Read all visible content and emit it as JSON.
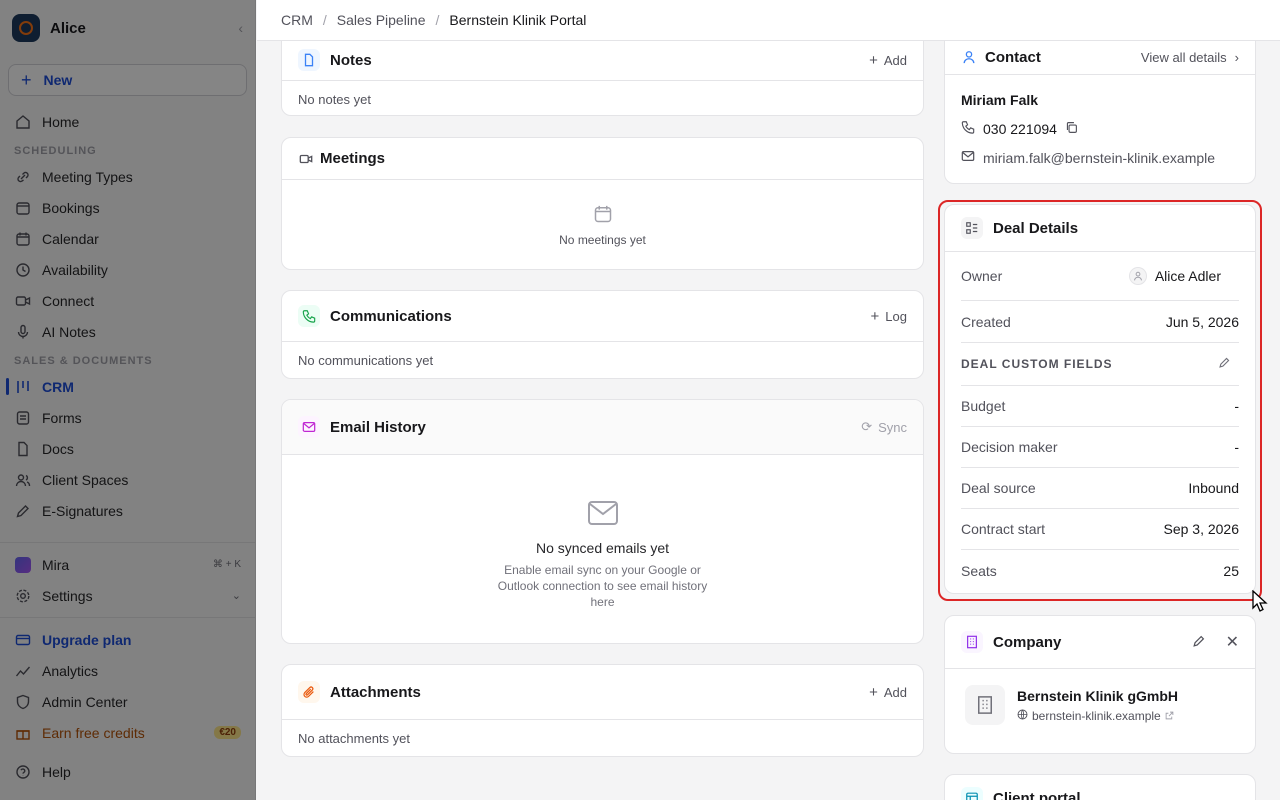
{
  "sidebar": {
    "workspace": "Alice",
    "new_label": "New",
    "home": "Home",
    "section_scheduling": "SCHEDULING",
    "scheduling": [
      "Meeting Types",
      "Bookings",
      "Calendar",
      "Availability",
      "Connect",
      "AI Notes"
    ],
    "section_sales": "SALES & DOCUMENTS",
    "sales": [
      "CRM",
      "Forms",
      "Docs",
      "Client Spaces",
      "E-Signatures"
    ],
    "mira": "Mira",
    "mira_kbd": "⌘ + K",
    "settings": "Settings",
    "upgrade": "Upgrade plan",
    "analytics": "Analytics",
    "admin": "Admin Center",
    "earn": "Earn free credits",
    "earn_badge": "€20",
    "help": "Help"
  },
  "breadcrumb": [
    "CRM",
    "Sales Pipeline",
    "Bernstein Klinik Portal"
  ],
  "notes": {
    "title": "Notes",
    "action": "Add",
    "empty": "No notes yet"
  },
  "meetings": {
    "title": "Meetings",
    "empty": "No meetings yet"
  },
  "communications": {
    "title": "Communications",
    "action": "Log",
    "empty": "No communications yet"
  },
  "email": {
    "title": "Email History",
    "action": "Sync",
    "empty_title": "No synced emails yet",
    "empty_desc": "Enable email sync on your Google or Outlook connection to see email history here"
  },
  "attachments": {
    "title": "Attachments",
    "action": "Add",
    "empty": "No attachments yet"
  },
  "contact": {
    "title": "Contact",
    "action": "View all details",
    "name": "Miriam Falk",
    "phone": "030 221094",
    "email": "miriam.falk@bernstein-klinik.example"
  },
  "deal": {
    "title": "Deal Details",
    "owner_label": "Owner",
    "owner": "Alice Adler",
    "created_label": "Created",
    "created": "Jun 5, 2026",
    "custom_header": "DEAL CUSTOM FIELDS",
    "fields": [
      {
        "label": "Budget",
        "value": "-"
      },
      {
        "label": "Decision maker",
        "value": "-"
      },
      {
        "label": "Deal source",
        "value": "Inbound"
      },
      {
        "label": "Contract start",
        "value": "Sep 3, 2026"
      },
      {
        "label": "Seats",
        "value": "25"
      }
    ]
  },
  "company": {
    "title": "Company",
    "name": "Bernstein Klinik gGmbH",
    "domain": "bernstein-klinik.example"
  },
  "portal": {
    "title": "Client portal"
  }
}
